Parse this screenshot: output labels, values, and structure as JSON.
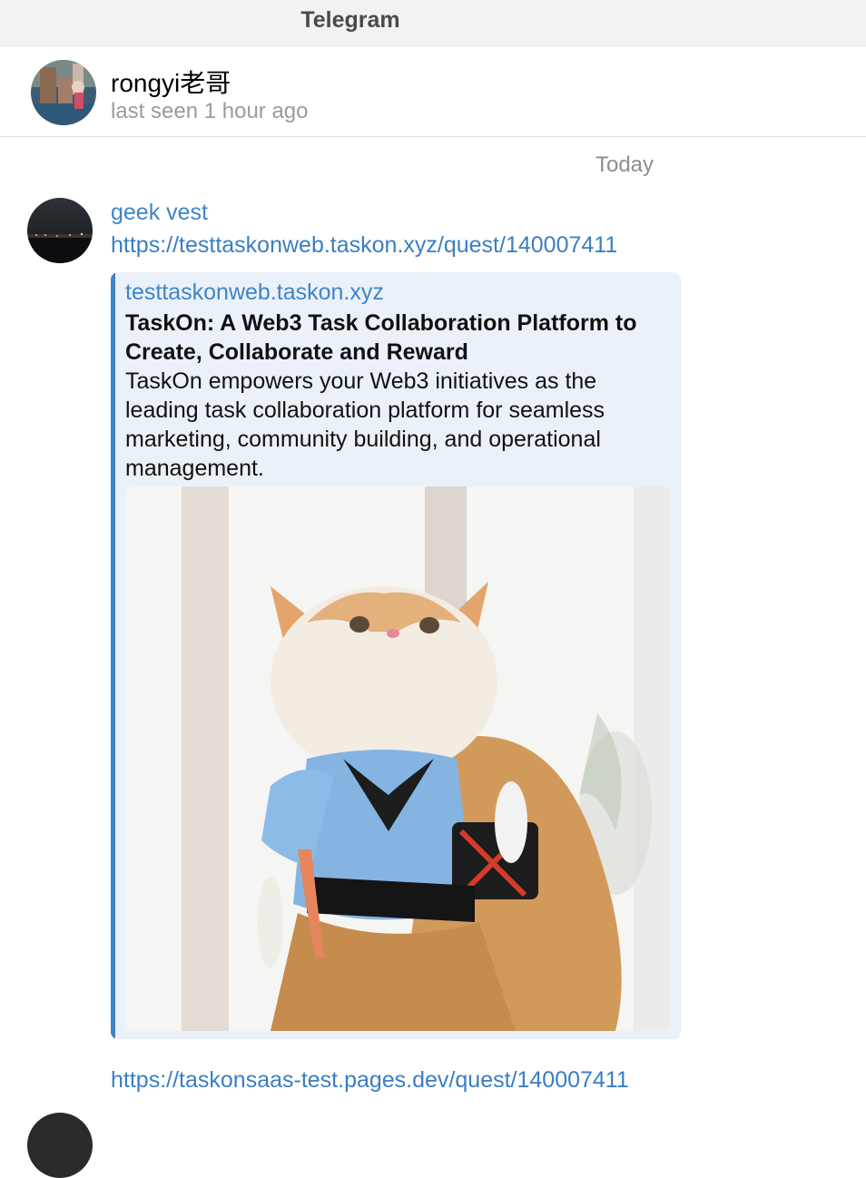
{
  "app": {
    "title": "Telegram"
  },
  "header": {
    "peer_name": "rongyi老哥",
    "status": "last seen 1 hour ago",
    "avatar_icon": "user-avatar"
  },
  "chat": {
    "date_separator": "Today",
    "messages": [
      {
        "sender": "geek vest",
        "avatar_icon": "user-avatar",
        "link": "https://testtaskonweb.taskon.xyz/quest/140007411",
        "preview": {
          "site": "testtaskonweb.taskon.xyz",
          "title": "TaskOn: A Web3 Task Collaboration Platform to Create, Collaborate and Reward",
          "description": "TaskOn empowers your Web3 initiatives as the leading task collaboration platform for seamless marketing, community building, and operational management.",
          "image_icon": "cat-in-costume-image"
        }
      },
      {
        "link": "https://taskonsaas-test.pages.dev/quest/140007411"
      }
    ]
  },
  "colors": {
    "accent": "#3f84c9",
    "preview_bg": "#ebf1f9",
    "titlebar_bg": "#f2f2f2",
    "muted_text": "#9b9b9b"
  }
}
